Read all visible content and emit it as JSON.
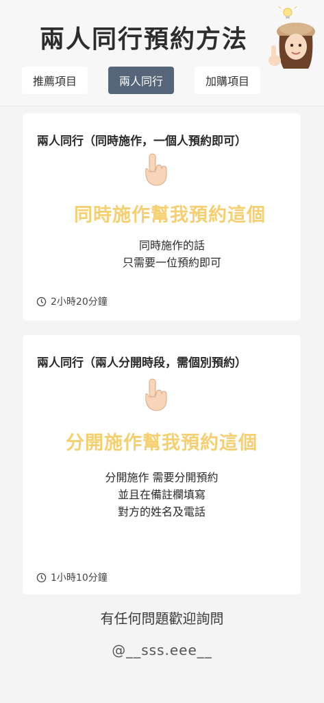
{
  "header": {
    "title": "兩人同行預約方法"
  },
  "tabs": [
    {
      "label": "推薦項目",
      "active": false
    },
    {
      "label": "兩人同行",
      "active": true
    },
    {
      "label": "加購項目",
      "active": false
    }
  ],
  "cards": [
    {
      "title": "兩人同行（同時施作，一個人預約即可）",
      "cta": "同時施作幫我預約這個",
      "desc_lines": [
        "同時施作的話",
        "只需要一位預約即可"
      ],
      "duration": "2小時20分鐘"
    },
    {
      "title": "兩人同行（兩人分開時段，需個別預約）",
      "cta": "分開施作幫我預約這個",
      "desc_lines": [
        "分開施作 需要分開預約",
        "並且在備註欄填寫",
        "對方的姓名及電話"
      ],
      "duration": "1小時10分鐘"
    }
  ],
  "footer": {
    "question": "有任何問題歡迎詢問",
    "handle": "@__sss.eee__"
  },
  "icons": {
    "pointer": "pointing-up-hand-icon",
    "clock": "clock-icon",
    "avatar": "memoji-avatar-icon"
  },
  "colors": {
    "active_tab": "#566579",
    "cta_yellow": "#f5cf70",
    "background": "#f4f4f5"
  }
}
